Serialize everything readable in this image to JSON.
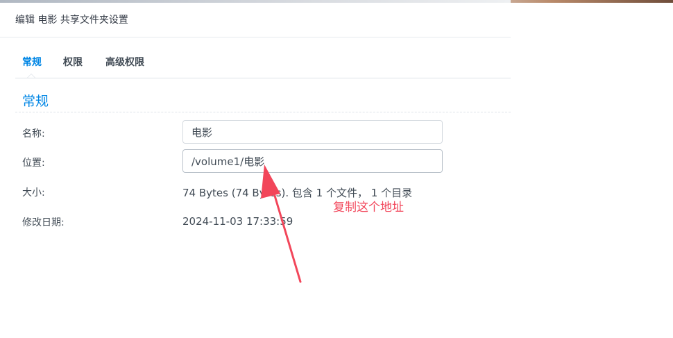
{
  "dialog": {
    "title": "编辑 电影 共享文件夹设置"
  },
  "tabs": [
    {
      "label": "常规",
      "active": true
    },
    {
      "label": "权限",
      "active": false
    },
    {
      "label": "高级权限",
      "active": false
    }
  ],
  "section": {
    "title": "常规"
  },
  "fields": {
    "name": {
      "label": "名称:",
      "value": "电影"
    },
    "location": {
      "label": "位置:",
      "value": "/volume1/电影"
    },
    "size": {
      "label": "大小:",
      "value": "74 Bytes (74 Bytes). 包含 1 个文件， 1 个目录"
    },
    "modified": {
      "label": "修改日期:",
      "value": "2024-11-03 17:33:59"
    }
  },
  "annotation": {
    "text": "复制这个地址",
    "color": "#f2465a"
  },
  "colors": {
    "accent": "#0086e5",
    "text": "#414b55",
    "divider": "#dde2e8"
  }
}
